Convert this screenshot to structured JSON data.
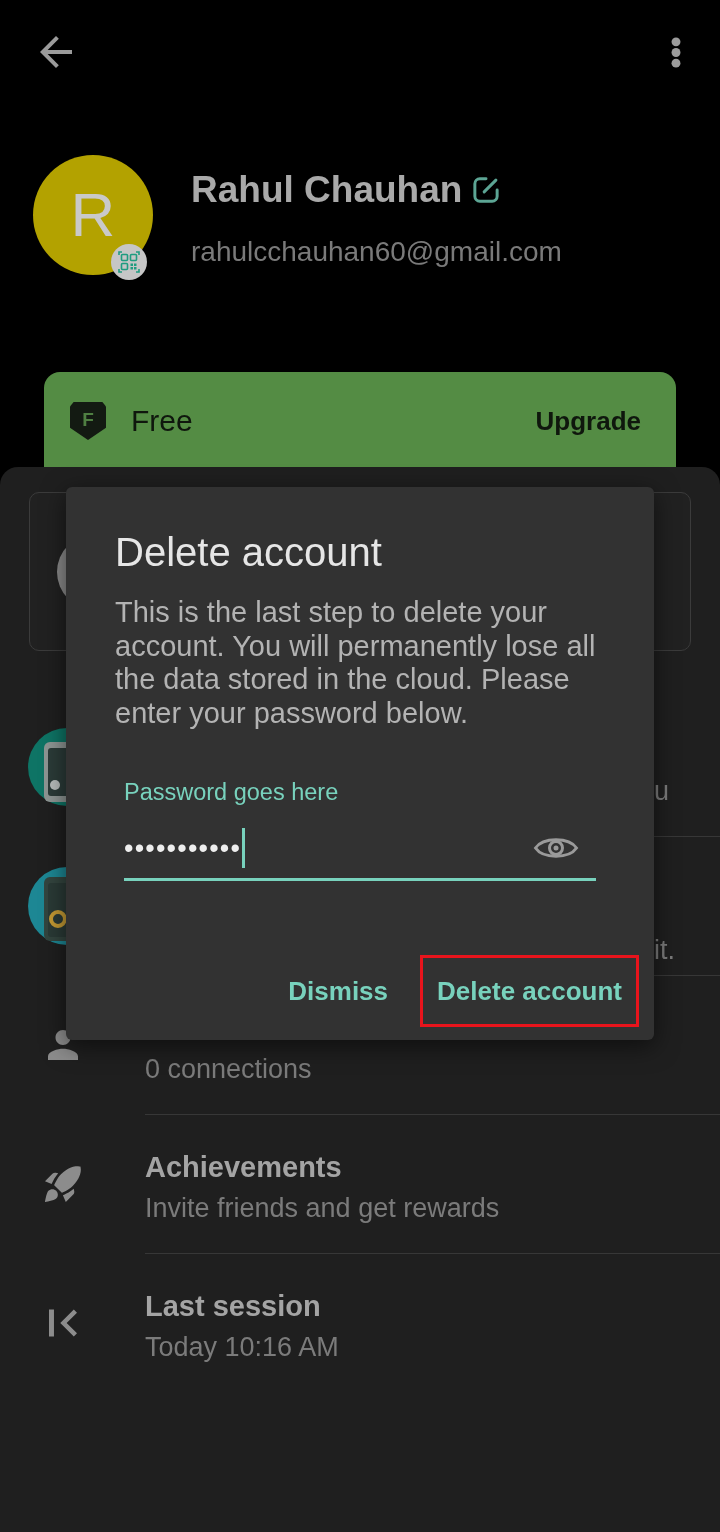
{
  "profile": {
    "initial": "R",
    "name": "Rahul Chauhan",
    "email": "rahulcchauhan60@gmail.com"
  },
  "plan": {
    "logo_letter": "F",
    "name": "Free",
    "action": "Upgrade"
  },
  "rows": [
    {
      "kind": "tablet",
      "subtitle": "u"
    },
    {
      "kind": "speaker",
      "subtitle": "it."
    },
    {
      "kind": "connections",
      "subtitle": "0 connections"
    },
    {
      "kind": "achievements",
      "title": "Achievements",
      "subtitle": "Invite friends and get rewards"
    },
    {
      "kind": "session",
      "title": "Last session",
      "subtitle": "Today 10:16 AM"
    }
  ],
  "dialog": {
    "title": "Delete account",
    "message": "This is the last step to delete your account. You will permanently lose all the data stored in the cloud. Please enter your password below.",
    "password_field": {
      "label": "Password goes here",
      "value": "•••••••••••",
      "focused": true
    },
    "buttons": [
      {
        "label": "Dismiss",
        "highlighted": false
      },
      {
        "label": "Delete account",
        "highlighted": true
      }
    ]
  }
}
